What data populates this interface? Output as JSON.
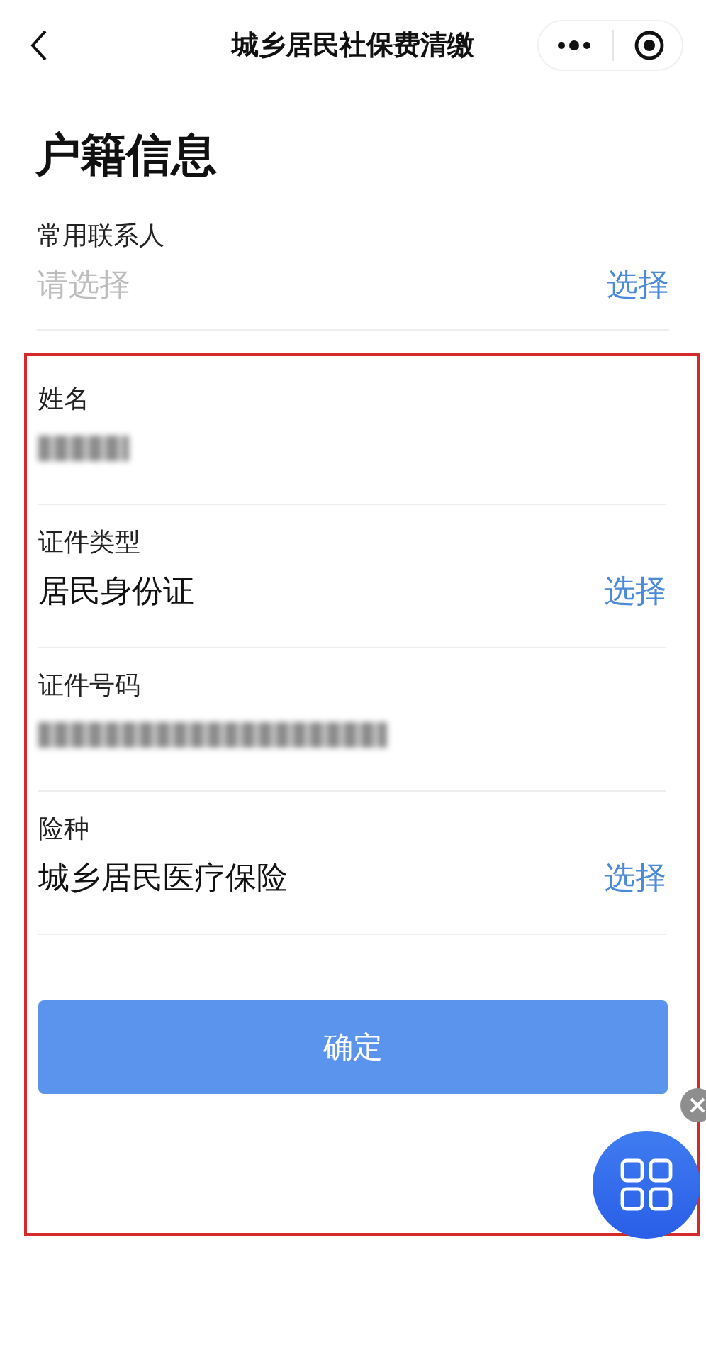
{
  "nav_bar": {
    "title": "城乡居民社保费清缴"
  },
  "page_title": "户籍信息",
  "fields": [
    {
      "kind": "select",
      "label": "常用联系人",
      "placeholder": "请选择",
      "action": "选择"
    }
  ],
  "highlighted_section": {
    "fields": [
      {
        "kind": "shortmask",
        "label": "姓名"
      },
      {
        "kind": "select",
        "label": "证件类型",
        "value": "居民身份证",
        "action": "选择"
      },
      {
        "kind": "longmask",
        "label": "证件号码"
      },
      {
        "kind": "select",
        "label": "险种",
        "value": "城乡居民医疗保险",
        "action": "选择"
      }
    ],
    "confirm_button": "确定"
  }
}
